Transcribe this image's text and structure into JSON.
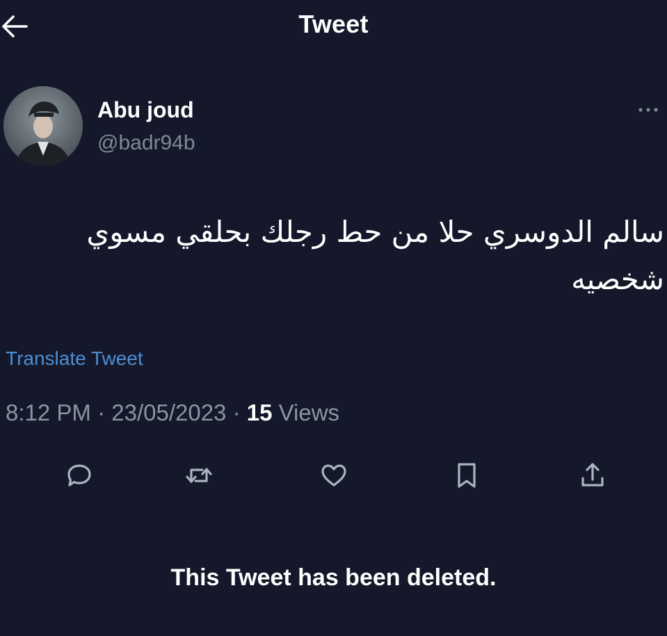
{
  "header": {
    "title": "Tweet",
    "back_icon": "arrow-left-icon"
  },
  "author": {
    "display_name": "Abu joud",
    "handle": "@badr94b",
    "avatar_icon": "avatar"
  },
  "tweet": {
    "text_line1": "سالم الدوسري حلا من حط رجلك بحلقي مسوي",
    "text_line2": "شخصيه",
    "translate_label": "Translate Tweet",
    "time": "8:12 PM",
    "separator": " · ",
    "date": "23/05/2023",
    "views_count": "15",
    "views_label": " Views"
  },
  "actions": [
    {
      "name": "reply",
      "icon": "comment-icon"
    },
    {
      "name": "retweet",
      "icon": "retweet-icon"
    },
    {
      "name": "like",
      "icon": "heart-icon"
    },
    {
      "name": "bookmark",
      "icon": "bookmark-icon"
    },
    {
      "name": "share",
      "icon": "share-icon"
    }
  ],
  "notice": {
    "deleted_text": "This Tweet has been deleted."
  },
  "colors": {
    "background": "#15182a",
    "primary_text": "#ffffff",
    "secondary_text": "#8b95a1",
    "link": "#4a8fd6",
    "icon": "#a9b4bf"
  }
}
